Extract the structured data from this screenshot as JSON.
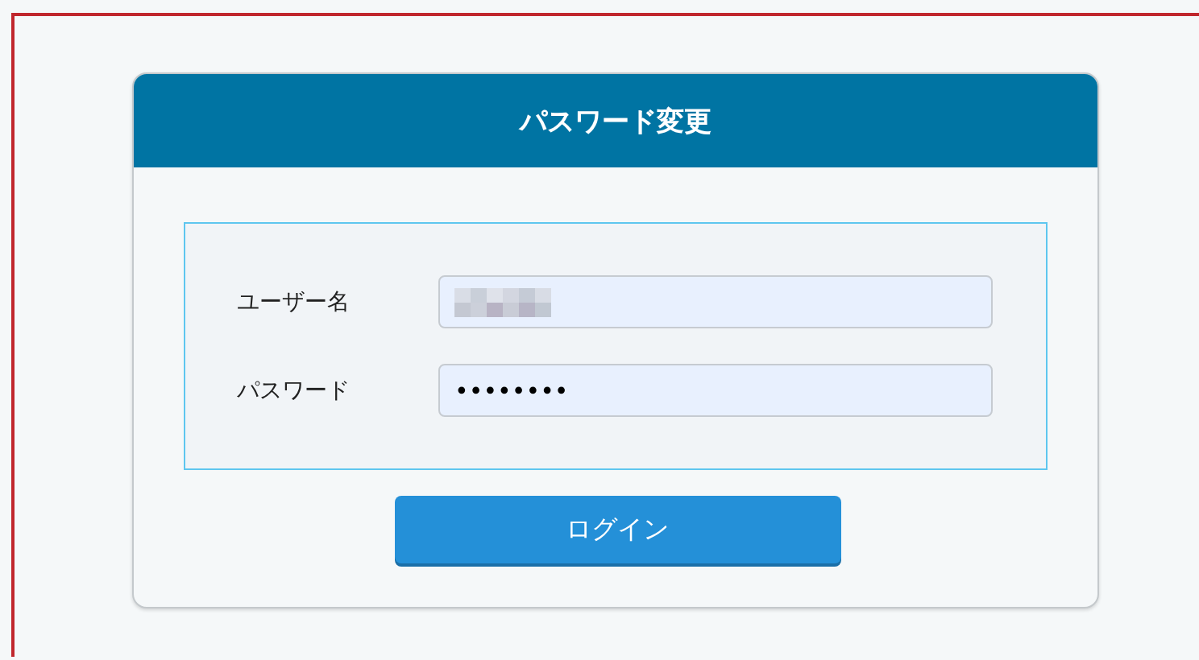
{
  "card": {
    "title": "パスワード変更"
  },
  "fields": [
    {
      "kind": "redacted",
      "label": "ユーザー名"
    },
    {
      "kind": "password",
      "label": "パスワード",
      "value": "••••••••"
    }
  ],
  "buttons": [
    "ログイン"
  ]
}
